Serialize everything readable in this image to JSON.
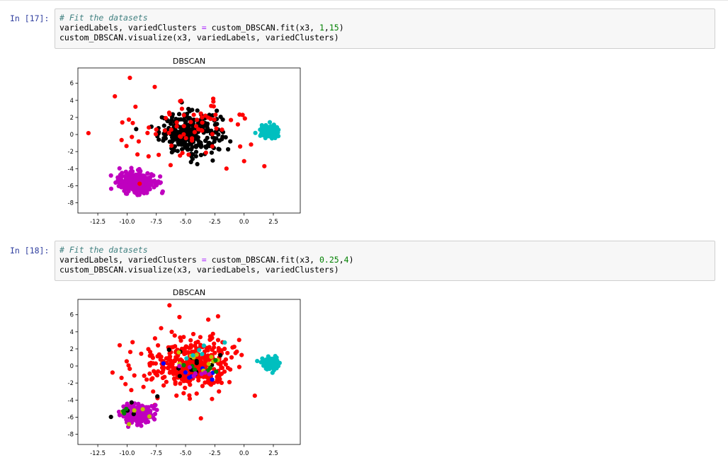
{
  "cells": [
    {
      "prompt": "In [17]:",
      "code": {
        "comment": "# Fit the datasets",
        "line2_a": "variedLabels, variedClusters ",
        "line2_op": "=",
        "line2_b": " custom_DBSCAN.fit(x3, ",
        "line2_n1": "1",
        "line2_c": ",",
        "line2_n2": "15",
        "line2_d": ")",
        "line3": "custom_DBSCAN.visualize(x3, variedLabels, variedClusters)"
      },
      "output": {
        "chart_data": {
          "type": "scatter",
          "title": "DBSCAN",
          "xlabel": "",
          "ylabel": "",
          "xlim": [
            -14.2,
            4.8
          ],
          "ylim": [
            -9.2,
            7.8
          ],
          "xticks": [
            "-12.5",
            "-10.0",
            "-7.5",
            "-5.0",
            "-2.5",
            "0.0",
            "2.5"
          ],
          "xtick_values": [
            -12.5,
            -10.0,
            -7.5,
            -5.0,
            -2.5,
            0.0,
            2.5
          ],
          "yticks": [
            "6",
            "4",
            "2",
            "0",
            "-2",
            "-4",
            "-6",
            "-8"
          ],
          "ytick_values": [
            6,
            4,
            2,
            0,
            -2,
            -4,
            -6,
            -8
          ],
          "grid": false,
          "clusters": [
            {
              "color": "#000000",
              "center": [
                -4.6,
                0.2
              ],
              "spread": [
                2.2,
                2.0
              ],
              "n": 300
            },
            {
              "color": "#bf00bf",
              "center": [
                -9.2,
                -5.6
              ],
              "spread": [
                1.25,
                1.0
              ],
              "n": 350
            },
            {
              "color": "#00bfbf",
              "center": [
                2.2,
                0.3
              ],
              "spread": [
                0.65,
                0.6
              ],
              "n": 170
            },
            {
              "color": "#ff0000",
              "center": [
                -5.0,
                0.5
              ],
              "spread": [
                5.0,
                3.5
              ],
              "n": 80
            }
          ]
        }
      }
    },
    {
      "prompt": "In [18]:",
      "code": {
        "comment": "# Fit the datasets",
        "line2_a": "variedLabels, variedClusters ",
        "line2_op": "=",
        "line2_b": " custom_DBSCAN.fit(x3, ",
        "line2_n1": "0.25",
        "line2_c": ",",
        "line2_n2": "4",
        "line2_d": ")",
        "line3": "custom_DBSCAN.visualize(x3, variedLabels, variedClusters)"
      },
      "output": {
        "chart_data": {
          "type": "scatter",
          "title": "DBSCAN",
          "xlabel": "",
          "ylabel": "",
          "xlim": [
            -14.2,
            4.8
          ],
          "ylim": [
            -9.2,
            7.8
          ],
          "xticks": [
            "-12.5",
            "-10.0",
            "-7.5",
            "-5.0",
            "-2.5",
            "0.0",
            "2.5"
          ],
          "xtick_values": [
            -12.5,
            -10.0,
            -7.5,
            -5.0,
            -2.5,
            0.0,
            2.5
          ],
          "yticks": [
            "6",
            "4",
            "2",
            "0",
            "-2",
            "-4",
            "-6",
            "-8"
          ],
          "ytick_values": [
            6,
            4,
            2,
            0,
            -2,
            -4,
            -6,
            -8
          ],
          "grid": false,
          "clusters": [
            {
              "color": "#ff0000",
              "center": [
                -4.6,
                0.2
              ],
              "spread": [
                2.6,
                2.2
              ],
              "n": 330
            },
            {
              "color": "#ff0000",
              "center": [
                -5.0,
                0.5
              ],
              "spread": [
                5.0,
                3.5
              ],
              "n": 90
            },
            {
              "color": "#bf00bf",
              "center": [
                -9.2,
                -5.6
              ],
              "spread": [
                1.0,
                0.8
              ],
              "n": 300
            },
            {
              "color": "#00bfbf",
              "center": [
                2.2,
                0.3
              ],
              "spread": [
                0.55,
                0.5
              ],
              "n": 150
            },
            {
              "color": "#000000",
              "center": [
                -4.6,
                0.0
              ],
              "spread": [
                2.3,
                1.8
              ],
              "n": 14
            },
            {
              "color": "#0000ff",
              "center": [
                -4.3,
                -0.8
              ],
              "spread": [
                1.8,
                1.2
              ],
              "n": 8
            },
            {
              "color": "#bfbf00",
              "center": [
                -4.0,
                0.3
              ],
              "spread": [
                2.0,
                1.4
              ],
              "n": 10
            },
            {
              "color": "#008000",
              "center": [
                -3.8,
                0.0
              ],
              "spread": [
                1.5,
                1.0
              ],
              "n": 7
            },
            {
              "color": "#00bfbf",
              "center": [
                -3.5,
                1.4
              ],
              "spread": [
                2.0,
                1.0
              ],
              "n": 6
            },
            {
              "color": "#bf00bf",
              "center": [
                -4.0,
                -0.2
              ],
              "spread": [
                2.0,
                1.2
              ],
              "n": 7
            },
            {
              "color": "#000000",
              "center": [
                -9.3,
                -5.4
              ],
              "spread": [
                1.6,
                1.2
              ],
              "n": 5
            },
            {
              "color": "#bfbf00",
              "center": [
                -9.0,
                -5.5
              ],
              "spread": [
                1.6,
                1.2
              ],
              "n": 5
            },
            {
              "color": "#008000",
              "center": [
                -9.6,
                -4.9
              ],
              "spread": [
                1.2,
                0.8
              ],
              "n": 3
            }
          ]
        }
      }
    }
  ]
}
